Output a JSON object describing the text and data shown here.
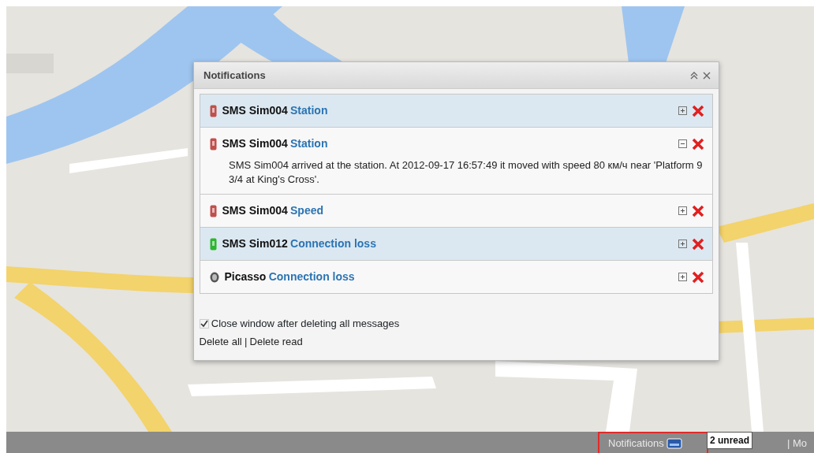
{
  "notifications_window": {
    "title": "Notifications",
    "items": [
      {
        "sender": "SMS Sim004",
        "event": "Station",
        "kind": "phone",
        "color": "#c0504d",
        "selected": true,
        "expanded": false
      },
      {
        "sender": "SMS Sim004",
        "event": "Station",
        "kind": "phone",
        "color": "#c0504d",
        "selected": false,
        "expanded": true,
        "message": "SMS Sim004 arrived at the station. At 2012-09-17 16:57:49 it moved with speed 80 км/ч near 'Platform 9 3/4 at King's Cross'."
      },
      {
        "sender": "SMS Sim004",
        "event": "Speed",
        "kind": "phone",
        "color": "#c0504d",
        "selected": false,
        "expanded": false
      },
      {
        "sender": "SMS Sim012",
        "event": "Connection loss",
        "kind": "phone",
        "color": "#2fb52f",
        "selected": true,
        "expanded": false
      },
      {
        "sender": "Picasso",
        "event": "Connection loss",
        "kind": "round",
        "selected": false,
        "expanded": false
      }
    ],
    "close_after_delete": {
      "label": "Close window after deleting all messages",
      "checked": true
    },
    "links": [
      "Delete all",
      "Delete read"
    ],
    "separator": "|"
  },
  "status_bar": {
    "notifications_label": "Notifications",
    "tooltip": "2 unread",
    "next_item": "| Mo",
    "highlighted": true
  }
}
